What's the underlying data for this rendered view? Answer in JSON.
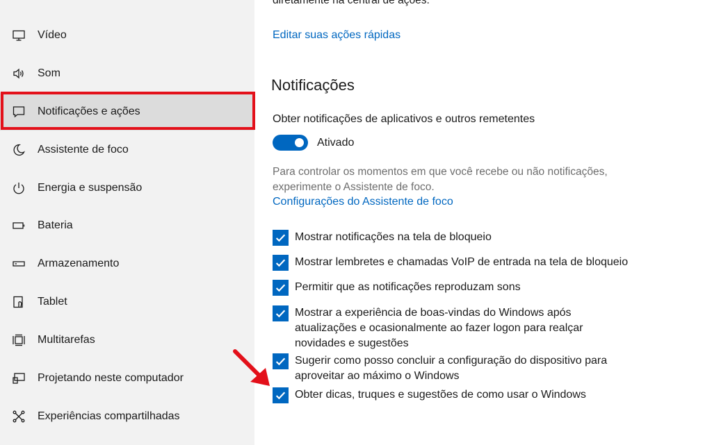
{
  "sidebar": {
    "items": [
      {
        "label": "Vídeo",
        "icon": "monitor-icon"
      },
      {
        "label": "Som",
        "icon": "speaker-icon"
      },
      {
        "label": "Notificações e ações",
        "icon": "message-icon",
        "selected": true
      },
      {
        "label": "Assistente de foco",
        "icon": "moon-icon"
      },
      {
        "label": "Energia e suspensão",
        "icon": "power-icon"
      },
      {
        "label": "Bateria",
        "icon": "battery-icon"
      },
      {
        "label": "Armazenamento",
        "icon": "storage-icon"
      },
      {
        "label": "Tablet",
        "icon": "tablet-icon"
      },
      {
        "label": "Multitarefas",
        "icon": "multitask-icon"
      },
      {
        "label": "Projetando neste computador",
        "icon": "project-icon"
      },
      {
        "label": "Experiências compartilhadas",
        "icon": "share-icon"
      }
    ]
  },
  "main": {
    "cut_text": "diretamente na central de ações.",
    "edit_quick_actions_link": "Editar suas ações rápidas",
    "section_title": "Notificações",
    "notifications_setting_label": "Obter notificações de aplicativos e outros remetentes",
    "toggle_state": "Ativado",
    "toggle_on": true,
    "focus_description": "Para controlar os momentos em que você recebe ou não notificações, experimente o Assistente de foco.",
    "focus_link": "Configurações do Assistente de foco",
    "checkboxes": [
      {
        "label": "Mostrar notificações na tela de bloqueio",
        "checked": true
      },
      {
        "label": "Mostrar lembretes e chamadas VoIP de entrada na tela de bloqueio",
        "checked": true
      },
      {
        "label": "Permitir que as notificações reproduzam sons",
        "checked": true
      },
      {
        "label": "Mostrar a experiência de boas-vindas do Windows após atualizações e ocasionalmente ao fazer logon para realçar novidades e sugestões",
        "checked": true
      },
      {
        "label": "Sugerir como posso concluir a configuração do dispositivo para aproveitar ao máximo o Windows",
        "checked": true
      },
      {
        "label": "Obter dicas, truques e sugestões de como usar o Windows",
        "checked": true
      }
    ]
  },
  "colors": {
    "accent": "#0067c0",
    "highlight_annotation": "#e3101a",
    "sidebar_bg": "#f2f2f2"
  }
}
